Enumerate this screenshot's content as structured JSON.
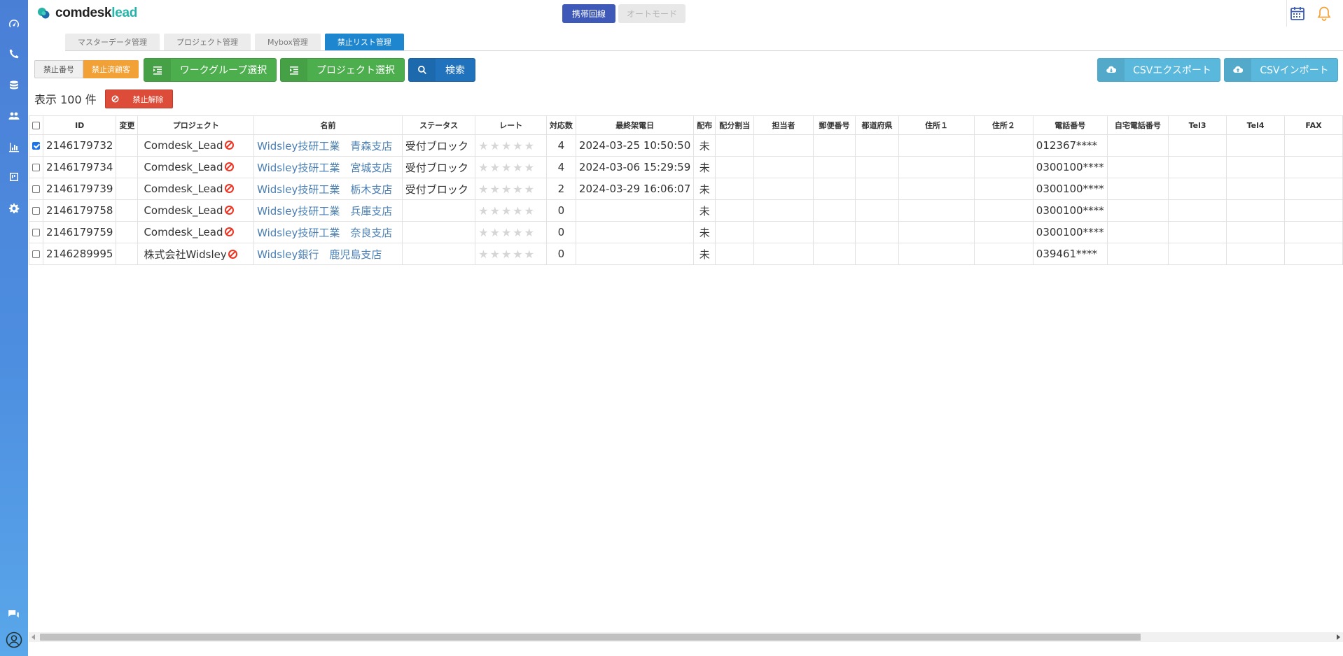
{
  "app": {
    "logo_main": "comdesk",
    "logo_accent": "lead"
  },
  "header": {
    "mobile_label": "携帯回線",
    "auto_label": "オートモード"
  },
  "tabs": [
    "マスターデータ管理",
    "プロジェクト管理",
    "Mybox管理",
    "禁止リスト管理"
  ],
  "toolbar": {
    "seg_number": "禁止番号",
    "seg_customer": "禁止済顧客",
    "workgroup_label": "ワークグループ選択",
    "project_label": "プロジェクト選択",
    "search_label": "検索",
    "csv_export_label": "CSVエクスポート",
    "csv_import_label": "CSVインポート"
  },
  "list": {
    "count_text": "表示 100 件",
    "unban_label": "禁止解除"
  },
  "table": {
    "headers": [
      "ID",
      "変更",
      "プロジェクト",
      "名前",
      "ステータス",
      "レート",
      "対応数",
      "最終架電日",
      "配布",
      "配分割当",
      "担当者",
      "郵便番号",
      "都道府県",
      "住所１",
      "住所２",
      "電話番号",
      "自宅電話番号",
      "Tel3",
      "Tel4",
      "FAX"
    ],
    "rows": [
      {
        "checked": true,
        "id": "2146179732",
        "project": "Comdesk_Lead",
        "name": "Widsley技研工業　青森支店",
        "status": "受付ブロック",
        "rating": 0,
        "count": "4",
        "last_call": "2024-03-25 10:50:50",
        "dist": "未",
        "phone": "012367****"
      },
      {
        "checked": false,
        "id": "2146179734",
        "project": "Comdesk_Lead",
        "name": "Widsley技研工業　宮城支店",
        "status": "受付ブロック",
        "rating": 0,
        "count": "4",
        "last_call": "2024-03-06 15:29:59",
        "dist": "未",
        "phone": "0300100****"
      },
      {
        "checked": false,
        "id": "2146179739",
        "project": "Comdesk_Lead",
        "name": "Widsley技研工業　栃木支店",
        "status": "受付ブロック",
        "rating": 0,
        "count": "2",
        "last_call": "2024-03-29 16:06:07",
        "dist": "未",
        "phone": "0300100****"
      },
      {
        "checked": false,
        "id": "2146179758",
        "project": "Comdesk_Lead",
        "name": "Widsley技研工業　兵庫支店",
        "status": "",
        "rating": 0,
        "count": "0",
        "last_call": "",
        "dist": "未",
        "phone": "0300100****"
      },
      {
        "checked": false,
        "id": "2146179759",
        "project": "Comdesk_Lead",
        "name": "Widsley技研工業　奈良支店",
        "status": "",
        "rating": 0,
        "count": "0",
        "last_call": "",
        "dist": "未",
        "phone": "0300100****"
      },
      {
        "checked": false,
        "id": "2146289995",
        "project": "株式会社Widsley",
        "name": "Widsley銀行　鹿児島支店",
        "status": "",
        "rating": 0,
        "count": "0",
        "last_call": "",
        "dist": "未",
        "phone": "039461****"
      }
    ]
  },
  "colors": {
    "sidebar": "#4a7fd6",
    "accent_blue": "#1e86cf",
    "mode_active": "#3e59b8",
    "green": "#4cae4c",
    "orange": "#f2a137",
    "red": "#dd4b39",
    "cyan": "#5ab8dc",
    "link": "#4a7fb4"
  },
  "icons": {
    "sidebar": [
      "dashboard-icon",
      "phone-icon",
      "database-icon",
      "users-icon",
      "bar-chart-icon",
      "board-icon",
      "gear-icon"
    ],
    "sidebar_bottom": [
      "chat-icon",
      "user-avatar-icon"
    ],
    "header": [
      "calendar-icon",
      "bell-icon"
    ]
  }
}
